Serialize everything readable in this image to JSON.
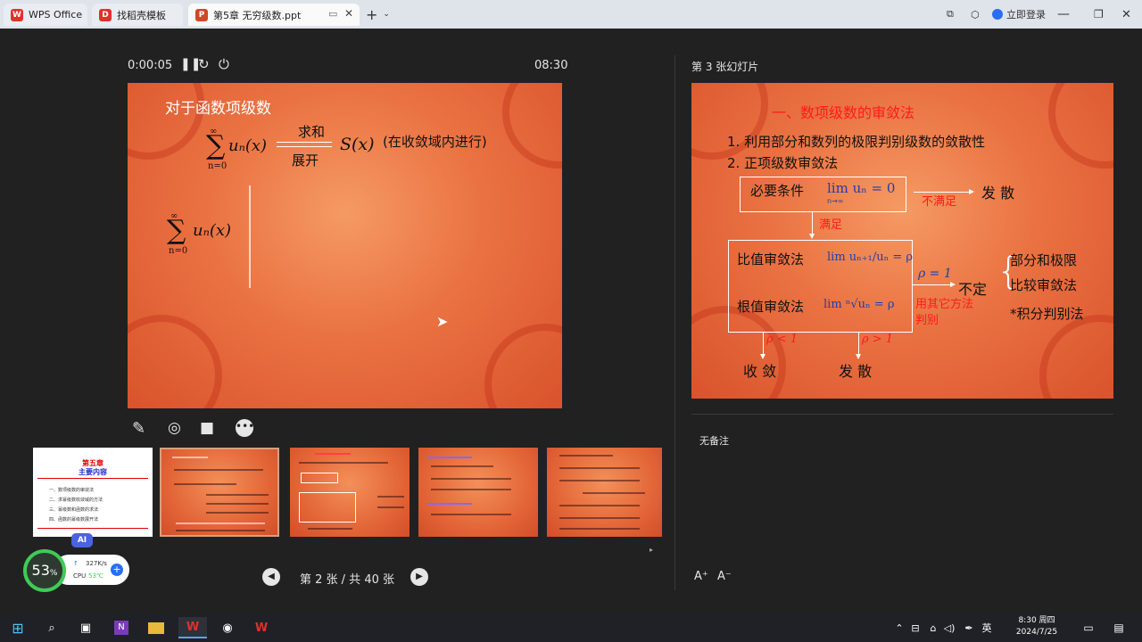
{
  "titlebar": {
    "tabs": [
      {
        "label": "WPS Office",
        "icon": "wps-logo-icon"
      },
      {
        "label": "找稻壳模板",
        "icon": "docer-icon"
      },
      {
        "label": "第5章  无穷级数.ppt",
        "icon": "ppt-icon"
      }
    ],
    "new_tab": "+",
    "login": "立即登录"
  },
  "presenter": {
    "elapsed": "0:00:05",
    "clock": "08:30",
    "next_slide_label": "第 3 张幻灯片",
    "notes": "无备注",
    "page_indicator": "第 2 张 / 共 40 张",
    "font_increase": "A⁺",
    "font_decrease": "A⁻"
  },
  "current_slide": {
    "title": "对于函数项级数",
    "sum_top": "∞",
    "sum_bottom": "n=0",
    "term": "uₙ(x)",
    "arrow_top": "求和",
    "arrow_bottom": "展开",
    "result": "S(x)",
    "note": "(在收敛域内进行)"
  },
  "next_slide": {
    "heading": "一、数项级数的审敛法",
    "item1": "1.  利用部分和数列的极限判别级数的敛散性",
    "item2": "2.  正项级数审敛法",
    "necessary": "必要条件",
    "necessary_formula": "lim uₙ = 0",
    "necessary_sub": "n→∞",
    "not_satisfied": "不满足",
    "diverge": "发  散",
    "satisfied": "满足",
    "ratio_test": "比值审敛法",
    "ratio_formula": "lim uₙ₊₁/uₙ = ρ",
    "root_test": "根值审敛法",
    "root_formula": "lim ⁿ√uₙ = ρ",
    "rho_eq": "ρ = 1",
    "undetermined": "不定",
    "other_methods": "用其它方法判别",
    "right_items": [
      "部分和极限",
      "比较审敛法",
      "*积分判别法"
    ],
    "rho_lt": "ρ < 1",
    "rho_gt": "ρ > 1",
    "converge": "收  敛",
    "diverge2": "发  散"
  },
  "thumbnails": {
    "first_title": "第五章",
    "first_subtitle": "主要内容",
    "first_lines": [
      "一、数项级数的审敛法",
      "二、求幂级数收敛域的方法",
      "三、幂级数和函数的求法",
      "四、函数的幂级数展开法"
    ]
  },
  "overlay": {
    "ai_badge": "AI",
    "percent": "53",
    "percent_unit": "%",
    "net_speed": "327K/s",
    "cpu_label": "CPU",
    "cpu_temp": "53℃"
  },
  "taskbar": {
    "ime": "英",
    "time": "8:30 周四",
    "date": "2024/7/25"
  },
  "colors": {
    "slide_red": "#d9532c",
    "accent_red": "#ff1a1a",
    "formula_blue": "#1f3fa8"
  }
}
